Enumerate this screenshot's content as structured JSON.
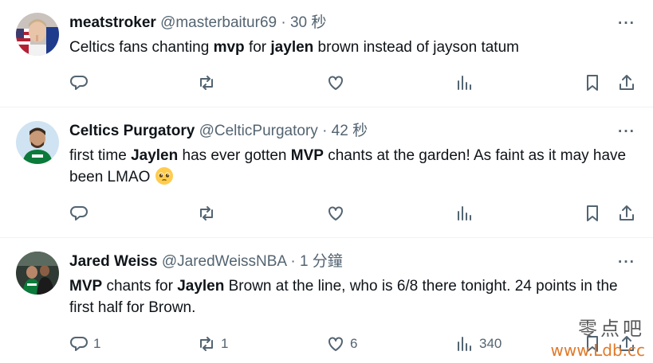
{
  "tweets": [
    {
      "name": "meatstroker",
      "handle": "@masterbaitur69",
      "dot": "·",
      "time": "30 秒",
      "text_parts": [
        "Celtics fans chanting ",
        "mvp",
        " for ",
        "jaylen",
        " brown instead of jayson tatum"
      ],
      "reply_count": "",
      "repost_count": "",
      "like_count": "",
      "view_count": ""
    },
    {
      "name": "Celtics Purgatory",
      "handle": "@CelticPurgatory",
      "dot": "·",
      "time": "42 秒",
      "text_parts": [
        "first time ",
        "Jaylen",
        " has ever gotten ",
        "MVP",
        " chants at the garden!  As faint as it may have been LMAO"
      ],
      "emoji": "pleading-face",
      "reply_count": "",
      "repost_count": "",
      "like_count": "",
      "view_count": ""
    },
    {
      "name": "Jared Weiss",
      "handle": "@JaredWeissNBA",
      "dot": "·",
      "time": "1 分鐘",
      "text_parts": [
        "MVP",
        " chants for ",
        "Jaylen",
        " Brown at the line, who is 6/8 there tonight. 24 points in the first half for Brown."
      ],
      "reply_count": "1",
      "repost_count": "1",
      "like_count": "6",
      "view_count": "340"
    }
  ],
  "more_label": "···",
  "icons": [
    "reply-icon",
    "repost-icon",
    "like-icon",
    "views-icon",
    "bookmark-icon",
    "share-icon"
  ],
  "watermark": {
    "line1": "零点吧",
    "line2": "www.Ldb.cc"
  },
  "colors": {
    "text": "#0f1419",
    "muted": "#536471",
    "divider": "#eff3f4"
  }
}
